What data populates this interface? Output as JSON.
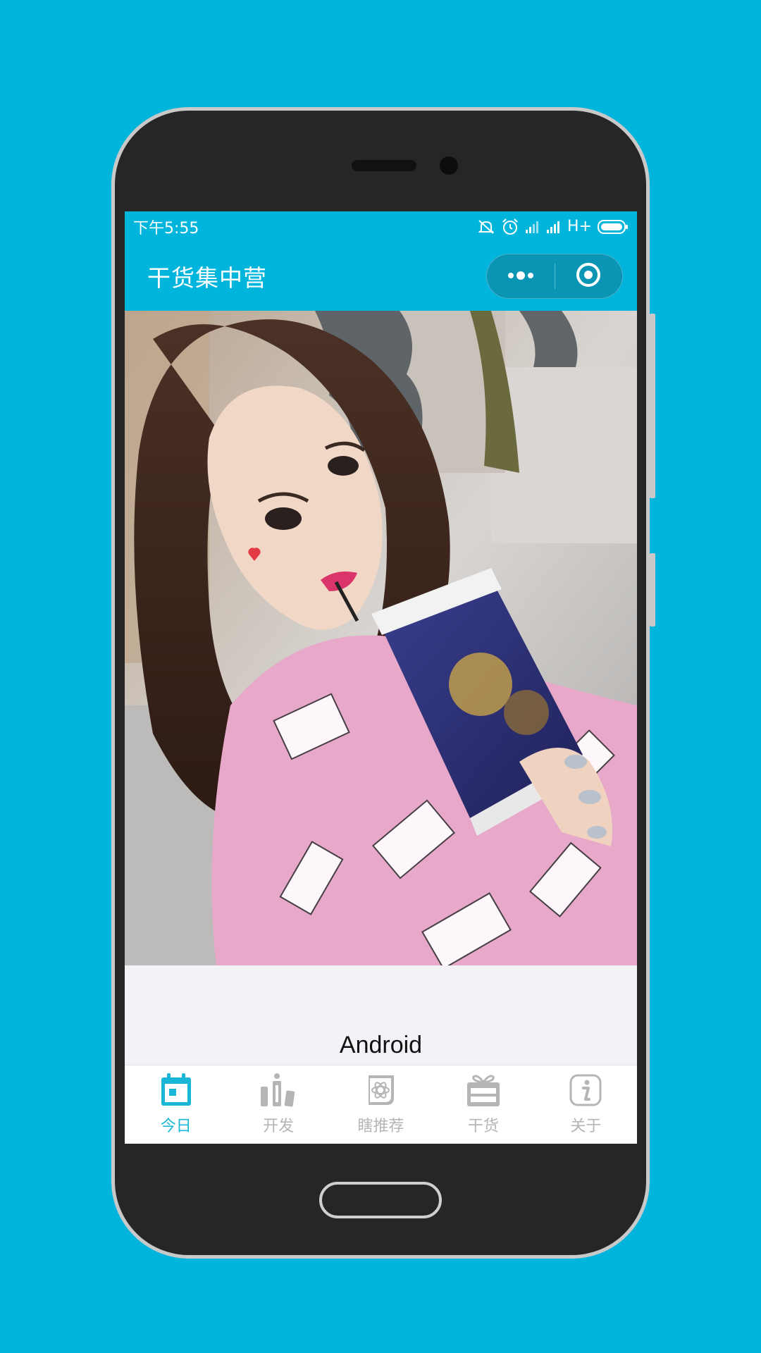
{
  "status_bar": {
    "time": "下午5:55",
    "network": "H+"
  },
  "nav": {
    "title": "干货集中营",
    "menu_icon": "more-dots-icon",
    "close_icon": "target-close-icon"
  },
  "content": {
    "photo": "selfie-photo",
    "caption": "Android"
  },
  "tabs": [
    {
      "label": "今日",
      "icon": "calendar-icon",
      "active": true
    },
    {
      "label": "开发",
      "icon": "bars-icon",
      "active": false
    },
    {
      "label": "瞎推荐",
      "icon": "atom-card-icon",
      "active": false
    },
    {
      "label": "干货",
      "icon": "gift-box-icon",
      "active": false
    },
    {
      "label": "关于",
      "icon": "info-icon",
      "active": false
    }
  ],
  "colors": {
    "primary": "#00b5dc",
    "tab_active": "#1ab6d8",
    "tab_inactive": "#b5b5b5",
    "phone_body": "#262626"
  }
}
